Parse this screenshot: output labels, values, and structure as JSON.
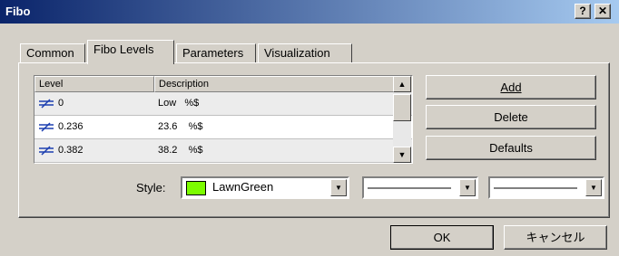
{
  "window": {
    "title": "Fibo",
    "help_label": "?",
    "close_label": "✕"
  },
  "tabs": [
    {
      "label": "Common"
    },
    {
      "label": "Fibo Levels"
    },
    {
      "label": "Parameters"
    },
    {
      "label": "Visualization"
    }
  ],
  "levels_table": {
    "columns": [
      "Level",
      "Description"
    ],
    "rows": [
      {
        "level": "0",
        "description": "Low   %$"
      },
      {
        "level": "0.236",
        "description": "23.6    %$"
      },
      {
        "level": "0.382",
        "description": "38.2    %$"
      }
    ]
  },
  "actions": {
    "add": "Add",
    "delete": "Delete",
    "defaults": "Defaults"
  },
  "style": {
    "label": "Style:",
    "color_name": "LawnGreen",
    "color_hex": "#7cfc00",
    "line_style": "solid",
    "line_width": "thin"
  },
  "footer": {
    "ok": "OK",
    "cancel": "キャンセル"
  },
  "colors": {
    "title_start": "#0a246a",
    "title_end": "#a6caf0",
    "level_icon": "#1c3fb0"
  }
}
